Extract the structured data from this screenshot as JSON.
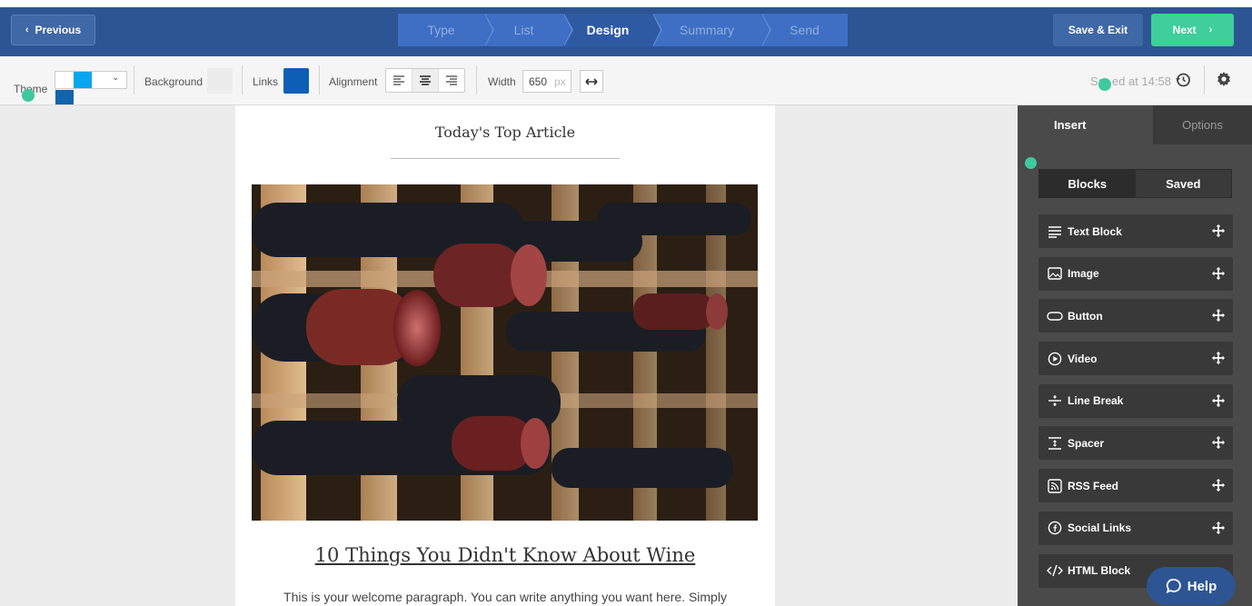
{
  "header": {
    "previous_label": "Previous",
    "steps": [
      {
        "label": "Type",
        "active": false
      },
      {
        "label": "List",
        "active": false
      },
      {
        "label": "Design",
        "active": true
      },
      {
        "label": "Summary",
        "active": false
      },
      {
        "label": "Send",
        "active": false
      }
    ],
    "save_exit_label": "Save & Exit",
    "next_label": "Next"
  },
  "toolbar": {
    "theme_label": "Theme",
    "background_label": "Background",
    "links_label": "Links",
    "alignment_label": "Alignment",
    "width_label": "Width",
    "width_value": "650",
    "width_unit": "px",
    "saved_prefix": "Sa",
    "saved_suffix": "ed at 14:58",
    "theme_colors": [
      "#ffffff",
      "#0aa6f0",
      "#1264ac"
    ],
    "background_color": "#ececec",
    "links_color": "#0c5fb4"
  },
  "email": {
    "heading": "Today's Top Article",
    "article_title": "10 Things You Didn't Know About Wine",
    "body": "This is your welcome paragraph. You can write anything you want here. Simply"
  },
  "panel": {
    "tabs": [
      "Insert",
      "Options"
    ],
    "segments": [
      "Blocks",
      "Saved"
    ],
    "blocks": [
      {
        "label": "Text Block",
        "icon": "text-lines-icon"
      },
      {
        "label": "Image",
        "icon": "image-icon"
      },
      {
        "label": "Button",
        "icon": "button-icon"
      },
      {
        "label": "Video",
        "icon": "video-play-icon"
      },
      {
        "label": "Line Break",
        "icon": "line-break-icon"
      },
      {
        "label": "Spacer",
        "icon": "spacer-icon"
      },
      {
        "label": "RSS Feed",
        "icon": "rss-icon"
      },
      {
        "label": "Social Links",
        "icon": "facebook-icon"
      },
      {
        "label": "HTML Block",
        "icon": "code-icon"
      }
    ]
  },
  "help_label": "Help"
}
